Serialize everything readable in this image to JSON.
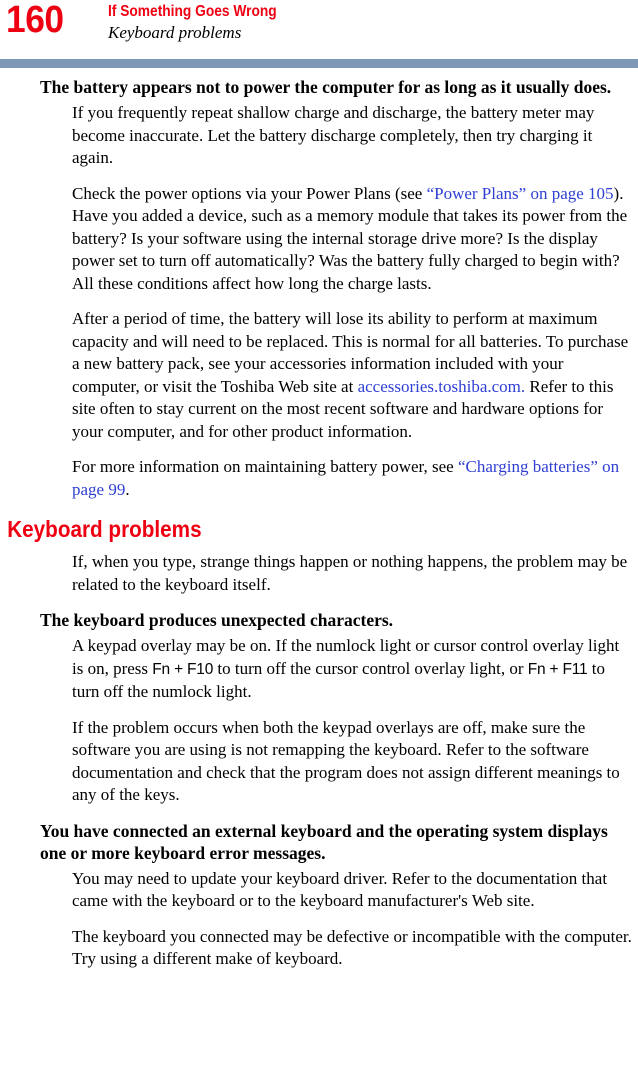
{
  "page": {
    "number": "160",
    "header_title": "If Something Goes Wrong",
    "header_subtitle": "Keyboard problems",
    "rule_color": "#7f98b5",
    "accent_color": "#ee0012",
    "link_color": "#2f3fd4"
  },
  "battery_section": {
    "problem_heading": "The battery appears not to power the computer for as long as it usually does.",
    "paragraph_1": "If you frequently repeat shallow charge and discharge, the battery meter may become inaccurate. Let the battery discharge completely, then try charging it again.",
    "paragraph_2": {
      "text_before_link": "Check the power options via your Power Plans (see ",
      "link_text": "“Power Plans” on page 105",
      "text_after_link": "). Have you added a device, such as a memory module that takes its power from the battery? Is your software using the internal storage drive more? Is the display power set to turn off automatically? Was the battery fully charged to begin with? All these conditions affect how long the charge lasts."
    },
    "paragraph_3": {
      "text_before_link": "After a period of time, the battery will lose its ability to perform at maximum capacity and will need to be replaced. This is normal for all batteries. To purchase a new battery pack, see your accessories information included with your computer, or visit the Toshiba Web site at ",
      "link_text": "accessories.toshiba.com.",
      "text_after_link": " Refer to this site often to stay current on the most recent software and hardware options for your computer, and for other product information."
    },
    "paragraph_4": {
      "text_before_link": "For more information on maintaining battery power, see ",
      "link_text": "“Charging batteries” on page 99",
      "text_after_link": "."
    }
  },
  "keyboard_section": {
    "heading": "Keyboard problems",
    "intro_paragraph": "If, when you type, strange things happen or nothing happens, the problem may be related to the keyboard itself.",
    "problem_1": {
      "heading": "The keyboard produces unexpected characters.",
      "paragraph_1": {
        "text_1": "A keypad overlay may be on. If the numlock light or cursor control overlay light is on, press ",
        "key_1": "Fn + F10",
        "text_2": " to turn off the cursor control overlay light, or ",
        "key_2": "Fn + F11",
        "text_3": " to turn off the numlock light."
      },
      "paragraph_2": "If the problem occurs when both the keypad overlays are off, make sure the software you are using is not remapping the keyboard. Refer to the software documentation and check that the program does not assign different meanings to any of the keys."
    },
    "problem_2": {
      "heading": "You have connected an external keyboard and the operating system displays one or more keyboard error messages.",
      "paragraph_1": "You may need to update your keyboard driver. Refer to the documentation that came with the keyboard or to the keyboard manufacturer's Web site.",
      "paragraph_2": "The keyboard you connected may be defective or incompatible with the computer. Try using a different make of keyboard."
    }
  }
}
